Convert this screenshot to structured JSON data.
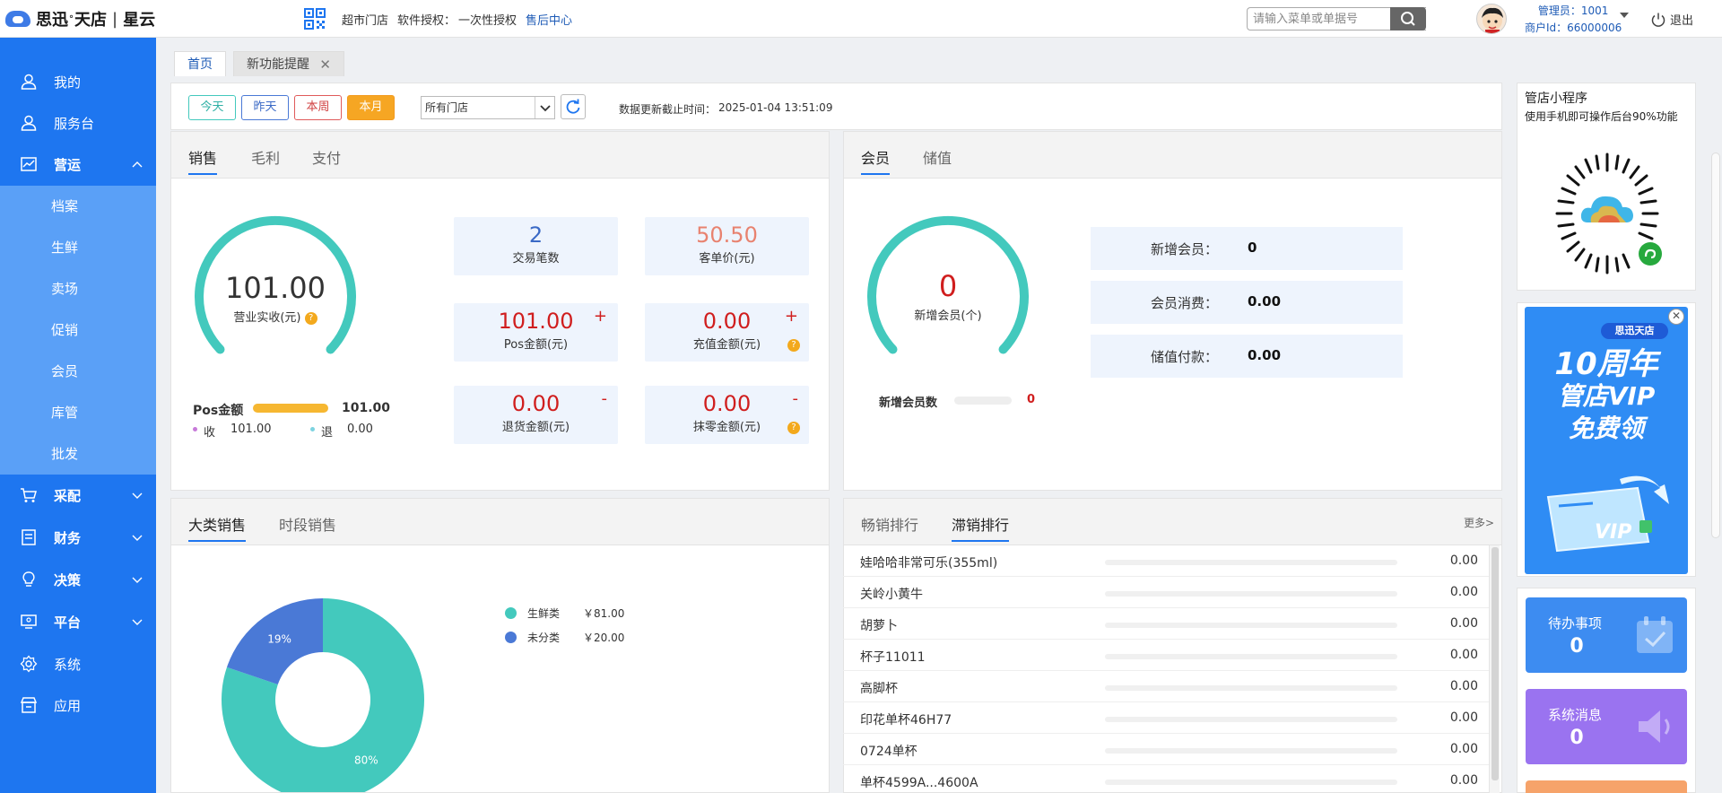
{
  "header": {
    "brand": "思迅",
    "brand_sub": "天店",
    "brand_sep": "|",
    "brand_product": "星云",
    "store_type": "超市门店",
    "license_label": "软件授权：",
    "license_value": "一次性授权",
    "after_sales": "售后中心",
    "search_placeholder": "请输入菜单或单据号",
    "admin_line": "管理员：1001",
    "merchant_line": "商户Id：66000006",
    "logout": "退出"
  },
  "sidebar": {
    "items": [
      {
        "label": "我的",
        "icon": "user-icon"
      },
      {
        "label": "服务台",
        "icon": "user-icon"
      },
      {
        "label": "营运",
        "icon": "chart-icon"
      }
    ],
    "sub_items": [
      "档案",
      "生鲜",
      "卖场",
      "促销",
      "会员",
      "库管",
      "批发"
    ],
    "items2": [
      {
        "label": "采配",
        "icon": "cart-icon"
      },
      {
        "label": "财务",
        "icon": "ledger-icon"
      },
      {
        "label": "决策",
        "icon": "bulb-icon"
      },
      {
        "label": "平台",
        "icon": "monitor-icon"
      },
      {
        "label": "系统",
        "icon": "gear-icon"
      },
      {
        "label": "应用",
        "icon": "store-icon"
      }
    ]
  },
  "page_tabs": {
    "home": "首页",
    "notice": "新功能提醒"
  },
  "filters": {
    "today": "今天",
    "yesterday": "昨天",
    "this_week": "本周",
    "this_month": "本月",
    "store_select": "所有门店",
    "update_label": "数据更新截止时间：",
    "update_time": "2025-01-04 13:51:09"
  },
  "sales": {
    "tabs": [
      "销售",
      "毛利",
      "支付"
    ],
    "revenue_value": "101.00",
    "revenue_label": "营业实收(元)",
    "pos_label": "Pos金额",
    "pos_value": "101.00",
    "income_label": "收",
    "income_value": "101.00",
    "refund_label": "退",
    "refund_value": "0.00",
    "cards": [
      {
        "value": "2",
        "label": "交易笔数"
      },
      {
        "value": "50.50",
        "label": "客单价(元)"
      },
      {
        "value": "101.00",
        "label": "Pos金额(元)",
        "sign": "+"
      },
      {
        "value": "0.00",
        "label": "充值金额(元)",
        "sign": "+"
      },
      {
        "value": "0.00",
        "label": "退货金额(元)",
        "sign": "-"
      },
      {
        "value": "0.00",
        "label": "抹零金额(元)",
        "sign": "-"
      }
    ]
  },
  "member": {
    "tabs": [
      "会员",
      "储值"
    ],
    "new_value": "0",
    "new_label": "新增会员(个)",
    "count_label": "新增会员数",
    "count_value": "0",
    "rows": [
      {
        "label": "新增会员：",
        "value": "0"
      },
      {
        "label": "会员消费：",
        "value": "0.00"
      },
      {
        "label": "储值付款：",
        "value": "0.00"
      }
    ]
  },
  "category": {
    "tabs": [
      "大类销售",
      "时段销售"
    ]
  },
  "chart_data": {
    "type": "pie",
    "categories": [
      "生鲜类",
      "未分类"
    ],
    "values": [
      81.0,
      20.0
    ],
    "value_labels": [
      "￥81.00",
      "￥20.00"
    ],
    "slice_labels": [
      "80%",
      "19%"
    ],
    "colors": [
      "#43c9bd",
      "#4a79d6"
    ]
  },
  "ranking": {
    "tabs": [
      "畅销排行",
      "滞销排行"
    ],
    "more": "更多>",
    "rows": [
      {
        "name": "娃哈哈非常可乐(355ml)",
        "value": "0.00"
      },
      {
        "name": "关岭小黄牛",
        "value": "0.00"
      },
      {
        "name": "胡萝卜",
        "value": "0.00"
      },
      {
        "name": "杯子11011",
        "value": "0.00"
      },
      {
        "name": "高脚杯",
        "value": "0.00"
      },
      {
        "name": "印花单杯46H77",
        "value": "0.00"
      },
      {
        "name": "0724单杯",
        "value": "0.00"
      },
      {
        "name": "单杯4599A...4600A",
        "value": "0.00"
      }
    ]
  },
  "right": {
    "mini_title": "管店小程序",
    "mini_desc": "使用手机即可操作后台90%功能",
    "ad_brand": "思迅天店",
    "ad_line1": "10周年",
    "ad_line2": "管店VIP",
    "ad_line3": "免费领",
    "todo_label": "待办事项",
    "todo_value": "0",
    "msg_label": "系统消息",
    "msg_value": "0"
  }
}
